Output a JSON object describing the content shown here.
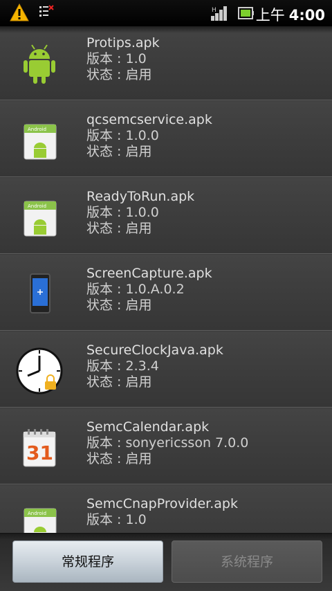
{
  "status_bar": {
    "ampm": "上午",
    "time": "4:00",
    "icons": [
      "warning-icon",
      "debug-icon",
      "signal-icon",
      "battery-icon"
    ]
  },
  "apps": [
    {
      "name": "Protips.apk",
      "version": "版本 : 1.0",
      "status": "状态 : 启用",
      "icon": "android-robot-icon"
    },
    {
      "name": "qcsemcservice.apk",
      "version": "版本 : 1.0.0",
      "status": "状态 : 启用",
      "icon": "android-package-icon"
    },
    {
      "name": "ReadyToRun.apk",
      "version": "版本 : 1.0.0",
      "status": "状态 : 启用",
      "icon": "android-package-icon"
    },
    {
      "name": "ScreenCapture.apk",
      "version": "版本 : 1.0.A.0.2",
      "status": "状态 : 启用",
      "icon": "phone-screen-icon"
    },
    {
      "name": "SecureClockJava.apk",
      "version": "版本 : 2.3.4",
      "status": "状态 : 启用",
      "icon": "clock-lock-icon"
    },
    {
      "name": "SemcCalendar.apk",
      "version": "版本 : sonyericsson 7.0.0",
      "status": "状态 : 启用",
      "icon": "calendar-icon"
    },
    {
      "name": "SemcCnapProvider.apk",
      "version": "版本 : 1.0",
      "status": "",
      "icon": "android-package-icon"
    }
  ],
  "tabs": {
    "regular": "常规程序",
    "system": "系统程序"
  },
  "colors": {
    "active_tab": "#c9d2da",
    "inactive_tab": "#4c4c4c",
    "background": "#3b3b3b"
  }
}
